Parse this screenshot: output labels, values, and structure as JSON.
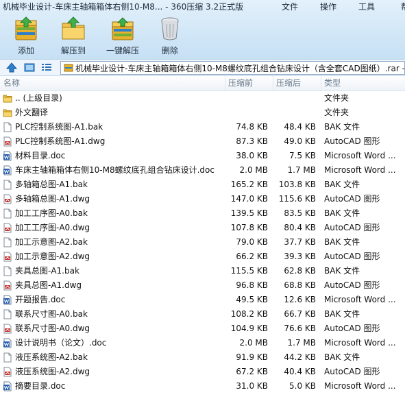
{
  "window": {
    "title": "机械毕业设计-车床主轴箱箱体右侧10-M8... - 360压缩 3.2正式版"
  },
  "menu": [
    "文件",
    "操作",
    "工具",
    "帮"
  ],
  "toolbar": {
    "add": "添加",
    "extract": "解压到",
    "oneclick": "一键解压",
    "delete": "删除"
  },
  "address": {
    "path": "机械毕业设计-车床主轴箱箱体右侧10-M8螺纹底孔组合钻床设计（含全套CAD图纸）.rar - 解"
  },
  "columns": {
    "name": "名称",
    "packed": "压缩前",
    "unpacked": "压缩后",
    "type": "类型"
  },
  "files": [
    {
      "name": ".. (上级目录)",
      "before": "",
      "after": "",
      "type": "文件夹",
      "icon": "folder-icon"
    },
    {
      "name": "外文翻译",
      "before": "",
      "after": "",
      "type": "文件夹",
      "icon": "folder-icon"
    },
    {
      "name": "PLC控制系统图-A1.bak",
      "before": "74.8 KB",
      "after": "48.4 KB",
      "type": "BAK 文件",
      "icon": "file-icon"
    },
    {
      "name": "PLC控制系统图-A1.dwg",
      "before": "87.3 KB",
      "after": "49.0 KB",
      "type": "AutoCAD 图形",
      "icon": "dwg-icon"
    },
    {
      "name": "材料目录.doc",
      "before": "38.0 KB",
      "after": "7.5 KB",
      "type": "Microsoft Word ...",
      "icon": "word-icon"
    },
    {
      "name": "车床主轴箱箱体右侧10-M8螺纹底孔组合钻床设计.doc",
      "before": "2.0 MB",
      "after": "1.7 MB",
      "type": "Microsoft Word ...",
      "icon": "word-icon"
    },
    {
      "name": "多轴箱总图-A1.bak",
      "before": "165.2 KB",
      "after": "103.8 KB",
      "type": "BAK 文件",
      "icon": "file-icon"
    },
    {
      "name": "多轴箱总图-A1.dwg",
      "before": "147.0 KB",
      "after": "115.6 KB",
      "type": "AutoCAD 图形",
      "icon": "dwg-icon"
    },
    {
      "name": "加工工序图-A0.bak",
      "before": "139.5 KB",
      "after": "83.5 KB",
      "type": "BAK 文件",
      "icon": "file-icon"
    },
    {
      "name": "加工工序图-A0.dwg",
      "before": "107.8 KB",
      "after": "80.4 KB",
      "type": "AutoCAD 图形",
      "icon": "dwg-icon"
    },
    {
      "name": "加工示意图-A2.bak",
      "before": "79.0 KB",
      "after": "37.7 KB",
      "type": "BAK 文件",
      "icon": "file-icon"
    },
    {
      "name": "加工示意图-A2.dwg",
      "before": "66.2 KB",
      "after": "39.3 KB",
      "type": "AutoCAD 图形",
      "icon": "dwg-icon"
    },
    {
      "name": "夹具总图-A1.bak",
      "before": "115.5 KB",
      "after": "62.8 KB",
      "type": "BAK 文件",
      "icon": "file-icon"
    },
    {
      "name": "夹具总图-A1.dwg",
      "before": "96.8 KB",
      "after": "68.8 KB",
      "type": "AutoCAD 图形",
      "icon": "dwg-icon"
    },
    {
      "name": "开题报告.doc",
      "before": "49.5 KB",
      "after": "12.6 KB",
      "type": "Microsoft Word ...",
      "icon": "word-icon"
    },
    {
      "name": "联系尺寸图-A0.bak",
      "before": "108.2 KB",
      "after": "66.7 KB",
      "type": "BAK 文件",
      "icon": "file-icon"
    },
    {
      "name": "联系尺寸图-A0.dwg",
      "before": "104.9 KB",
      "after": "76.6 KB",
      "type": "AutoCAD 图形",
      "icon": "dwg-icon"
    },
    {
      "name": "设计说明书（论文）.doc",
      "before": "2.0 MB",
      "after": "1.7 MB",
      "type": "Microsoft Word ...",
      "icon": "word-icon"
    },
    {
      "name": "液压系统图-A2.bak",
      "before": "91.9 KB",
      "after": "44.2 KB",
      "type": "BAK 文件",
      "icon": "file-icon"
    },
    {
      "name": "液压系统图-A2.dwg",
      "before": "67.2 KB",
      "after": "40.4 KB",
      "type": "AutoCAD 图形",
      "icon": "dwg-icon"
    },
    {
      "name": "摘要目录.doc",
      "before": "31.0 KB",
      "after": "5.0 KB",
      "type": "Microsoft Word ...",
      "icon": "word-icon"
    }
  ]
}
